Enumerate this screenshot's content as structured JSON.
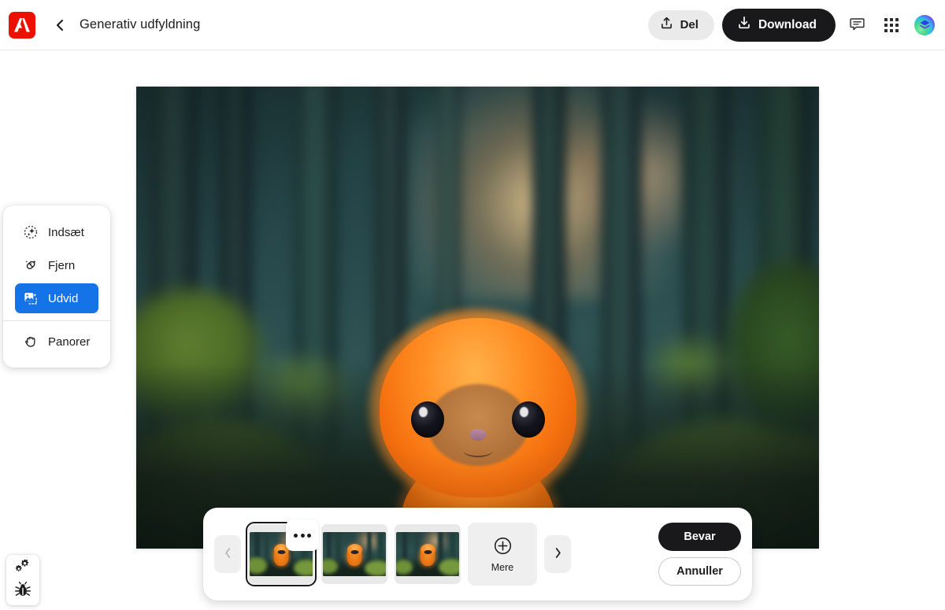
{
  "header": {
    "logo_name": "adobe-logo",
    "back_label": "chevron-left-icon",
    "title": "Generativ udfyldning",
    "share_label": "Del",
    "download_label": "Download",
    "feedback_icon": "speech-bubble-icon",
    "apps_icon": "app-grid-icon",
    "avatar_icon": "user-avatar"
  },
  "toolbar": {
    "items": [
      {
        "label": "Indsæt",
        "icon": "sparkle-circle-icon",
        "selected": false
      },
      {
        "label": "Fjern",
        "icon": "eraser-sparkle-icon",
        "selected": false
      },
      {
        "label": "Udvid",
        "icon": "expand-image-icon",
        "selected": true
      },
      {
        "label": "Panorer",
        "icon": "hand-icon",
        "selected": false
      }
    ],
    "selected_color": "#1473e6"
  },
  "canvas": {
    "description": "Fluffy orange creature sitting on mossy forest floor",
    "variation_count": 3
  },
  "filmstrip": {
    "prev_label": "chevron-left-icon",
    "next_label": "chevron-right-icon",
    "thumbnails": [
      {
        "name": "variation-1",
        "selected": true
      },
      {
        "name": "variation-2",
        "selected": false
      },
      {
        "name": "variation-3",
        "selected": false
      }
    ],
    "thumb_more_label": "ellipsis-icon",
    "more_label": "Mere",
    "more_icon": "plus-circle-icon",
    "keep_label": "Bevar",
    "cancel_label": "Annuller"
  },
  "dev_panel": {
    "settings_icon": "gears-icon",
    "bug_icon": "bug-icon"
  },
  "colors": {
    "accent_blue": "#1473e6",
    "adobe_red": "#eb1000",
    "dark_button": "#19191b",
    "light_button": "#eaeaea"
  }
}
